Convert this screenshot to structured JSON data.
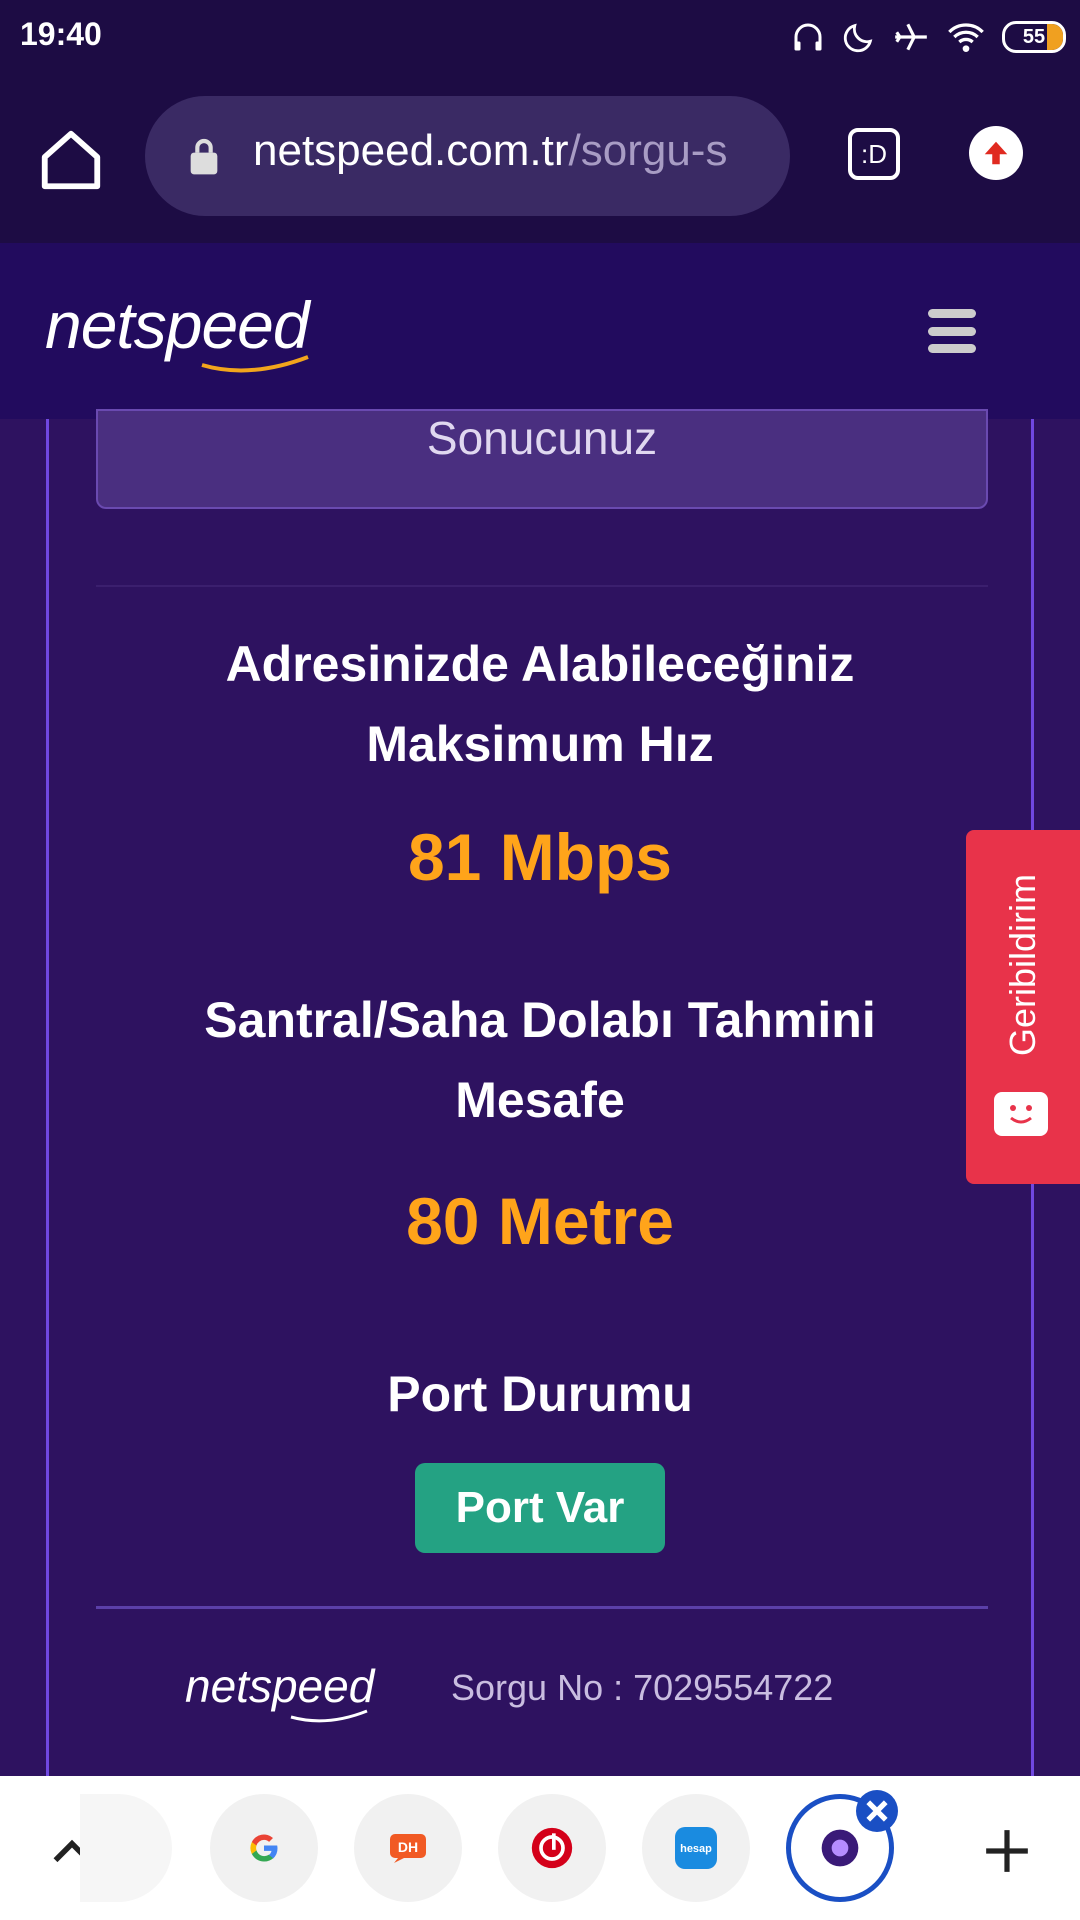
{
  "status_bar": {
    "time": "19:40",
    "battery": "55"
  },
  "browser": {
    "url_domain": "netspeed.com.tr",
    "url_path": "/sorgu-s",
    "tabs_label": ":D"
  },
  "site": {
    "logo": "netspeed"
  },
  "result": {
    "header": "Sonucunuz",
    "max_speed_label_line1": "Adresinizde Alabileceğiniz",
    "max_speed_label_line2": "Maksimum Hız",
    "max_speed_value": "81 Mbps",
    "distance_label_line1": "Santral/Saha Dolabı Tahmini",
    "distance_label_line2": "Mesafe",
    "distance_value": "80 Metre",
    "port_label": "Port Durumu",
    "port_value": "Port Var",
    "footer_logo": "netspeed",
    "query_no": "Sorgu No : 7029554722"
  },
  "feedback": {
    "label": "Geribildirim"
  },
  "colors": {
    "accent_orange": "#ffa41a",
    "port_green": "#24a283",
    "feedback_red": "#e8334a",
    "bg_purple": "#2e1260"
  }
}
